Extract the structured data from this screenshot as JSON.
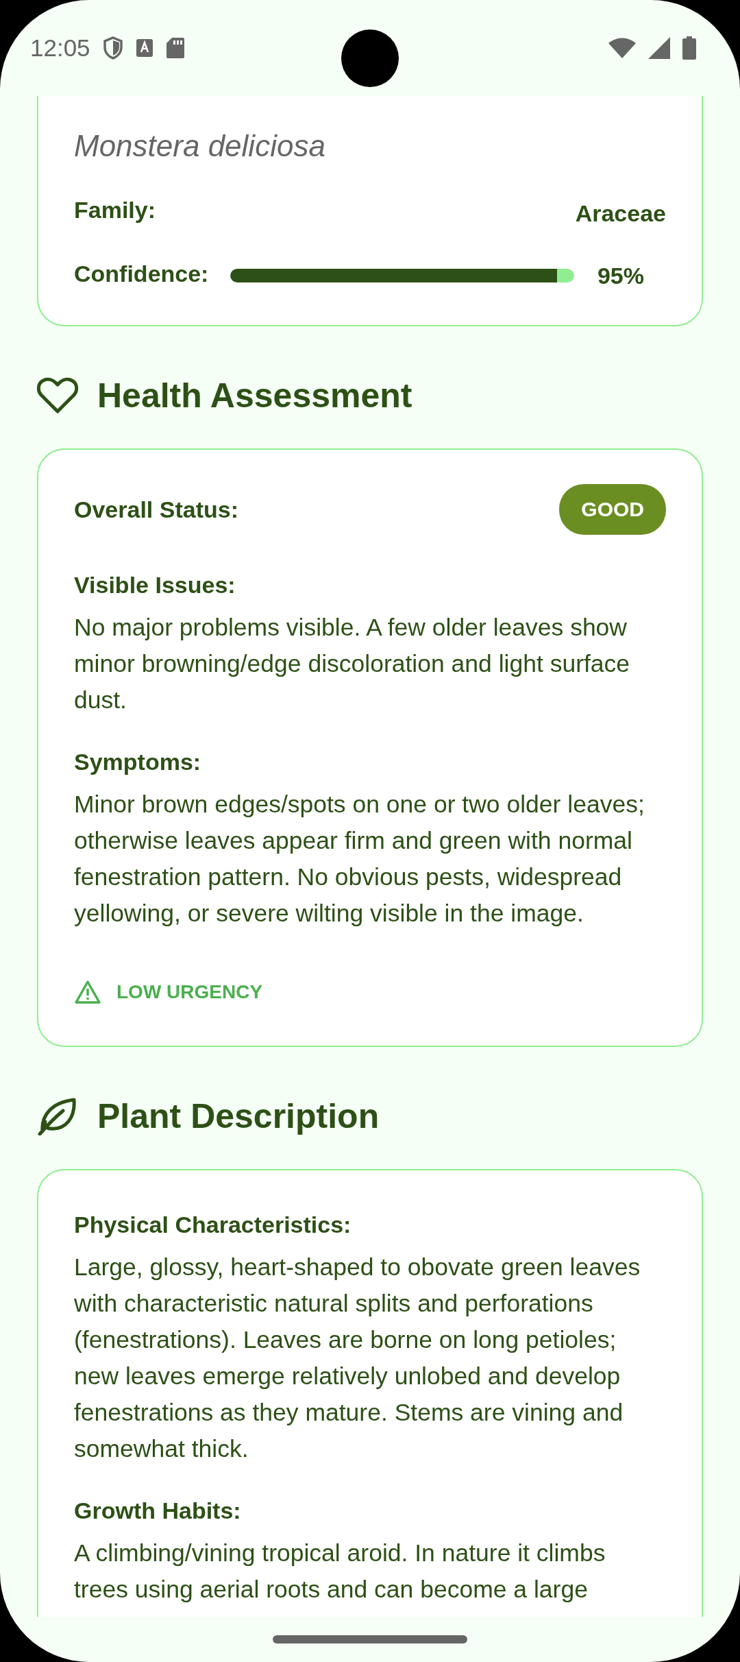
{
  "status_bar": {
    "time": "12:05"
  },
  "identification": {
    "scientific_name": "Monstera deliciosa",
    "family_label": "Family:",
    "family": "Araceae",
    "confidence_label": "Confidence:",
    "confidence": {
      "level": 0.95,
      "reading": "95%"
    }
  },
  "health": {
    "title": "Health Assessment",
    "status_label": "Overall Status:",
    "status": {
      "text": "GOOD",
      "kind": "good"
    },
    "sections": [
      {
        "label": "Visible Issues:",
        "text": "No major problems visible. A few older leaves show minor browning/edge discoloration and light surface dust."
      },
      {
        "label": "Symptoms:",
        "text": "Minor brown edges/spots on one or two older leaves; otherwise leaves appear firm and green with normal fenestration pattern. No obvious pests, widespread yellowing, or severe wilting visible in the image."
      }
    ],
    "urgency": {
      "text": "LOW URGENCY",
      "kind": "low"
    }
  },
  "description": {
    "title": "Plant Description",
    "sections": [
      {
        "label": "Physical Characteristics:",
        "text": "Large, glossy, heart-shaped to obovate green leaves with characteristic natural splits and perforations (fenestrations). Leaves are borne on long petioles; new leaves emerge relatively unlobed and develop fenestrations as they mature. Stems are vining and somewhat thick."
      },
      {
        "label": "Growth Habits:",
        "text": "A climbing/vining tropical aroid. In nature it climbs trees using aerial roots and can become a large"
      }
    ]
  }
}
